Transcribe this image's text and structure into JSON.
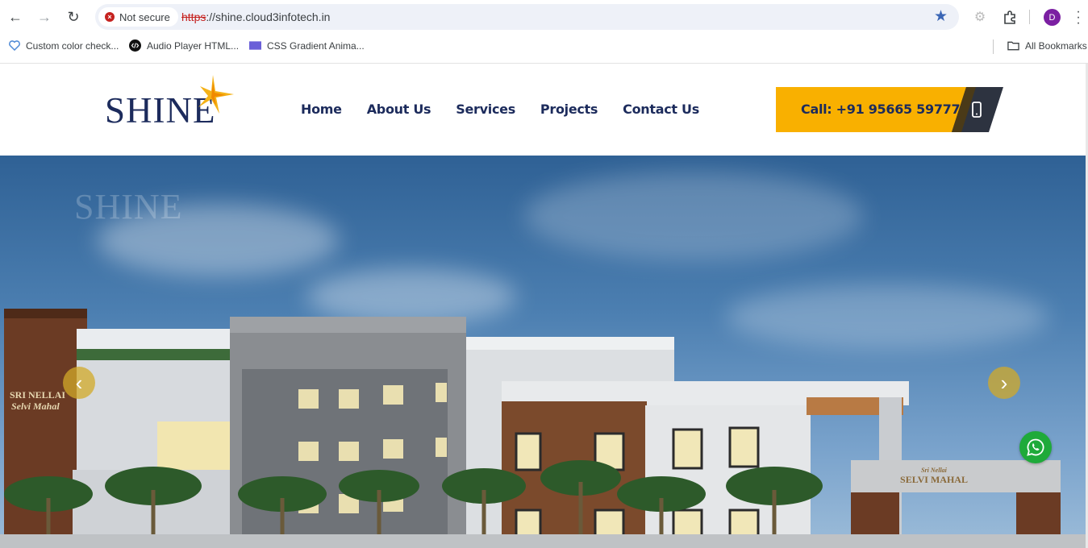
{
  "browser": {
    "security_label": "Not secure",
    "url_scheme": "https",
    "url_rest": "://shine.cloud3infotech.in",
    "profile_initial": "D",
    "bookmarks": [
      {
        "label": "Custom color check...",
        "icon": "heart-icon"
      },
      {
        "label": "Audio Player HTML...",
        "icon": "code-icon"
      },
      {
        "label": "CSS Gradient Anima...",
        "icon": "gradient-icon"
      }
    ],
    "all_bookmarks_label": "All Bookmarks"
  },
  "site": {
    "logo_text": "SHINE",
    "watermark_text": "SHINE",
    "nav": [
      {
        "label": "Home"
      },
      {
        "label": "About Us"
      },
      {
        "label": "Services"
      },
      {
        "label": "Projects"
      },
      {
        "label": "Contact Us"
      }
    ],
    "cta_label": "Call: +91 95665 59777",
    "hero": {
      "signage_left_line1": "SRI NELLAI",
      "signage_left_line2": "Selvi Mahal",
      "signage_gate_line1": "Sri Nellai",
      "signage_gate_line2": "SELVI MAHAL"
    }
  },
  "colors": {
    "brand_navy": "#1c2b5c",
    "cta_yellow": "#f9b000",
    "whatsapp_green": "#1faa3a"
  }
}
